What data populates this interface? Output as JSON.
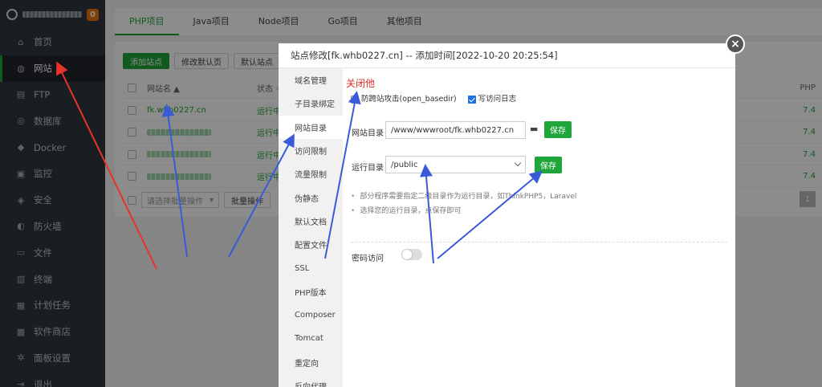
{
  "sidebar": {
    "badge": "0",
    "items": [
      {
        "label": "首页",
        "icon": "home-icon",
        "glyph": "⌂"
      },
      {
        "label": "网站",
        "icon": "globe-icon",
        "glyph": "◍"
      },
      {
        "label": "FTP",
        "icon": "ftp-icon",
        "glyph": "▤"
      },
      {
        "label": "数据库",
        "icon": "database-icon",
        "glyph": "◎"
      },
      {
        "label": "Docker",
        "icon": "docker-icon",
        "glyph": "◆"
      },
      {
        "label": "监控",
        "icon": "monitor-icon",
        "glyph": "▣"
      },
      {
        "label": "安全",
        "icon": "shield-icon",
        "glyph": "◈"
      },
      {
        "label": "防火墙",
        "icon": "firewall-icon",
        "glyph": "◐"
      },
      {
        "label": "文件",
        "icon": "folder-icon",
        "glyph": "▭"
      },
      {
        "label": "终端",
        "icon": "terminal-icon",
        "glyph": "▥"
      },
      {
        "label": "计划任务",
        "icon": "calendar-icon",
        "glyph": "▦"
      },
      {
        "label": "软件商店",
        "icon": "apps-icon",
        "glyph": "▩"
      },
      {
        "label": "面板设置",
        "icon": "gear-icon",
        "glyph": "✲"
      },
      {
        "label": "退出",
        "icon": "logout-icon",
        "glyph": "⇥"
      }
    ],
    "active_index": 1
  },
  "tabs": [
    "PHP项目",
    "Java项目",
    "Node项目",
    "Go项目",
    "其他项目"
  ],
  "toolbar": {
    "add_site": "添加站点",
    "default_page": "修改默认页",
    "default_site": "默认站点",
    "php": "PH"
  },
  "table": {
    "col_name": "网站名 ▲",
    "col_status": "状态 ◦",
    "col_php": "PHP",
    "rows": [
      {
        "name": "fk.whb0227.cn",
        "status": "运行中",
        "php": "7.4"
      },
      {
        "name": "",
        "status": "运行中",
        "php": "7.4"
      },
      {
        "name": "",
        "status": "运行中",
        "php": "7.4"
      },
      {
        "name": "",
        "status": "运行中",
        "php": "7.4"
      }
    ],
    "batch_select": "请选择批量操作",
    "batch_btn": "批量操作",
    "page": "1"
  },
  "modal": {
    "title": "站点修改[fk.whb0227.cn] -- 添加时间[2022-10-20 20:25:54]",
    "menu": [
      "域名管理",
      "子目录绑定",
      "网站目录",
      "访问限制",
      "流量限制",
      "伪静态",
      "默认文档",
      "配置文件",
      "SSL",
      "PHP版本",
      "Composer",
      "Tomcat",
      "重定向",
      "反向代理"
    ],
    "active_menu": 2,
    "note": "关闭他",
    "cb_basedir": "防跨站攻击(open_basedir)",
    "cb_log": "写访问日志",
    "site_dir_label": "网站目录",
    "site_dir_value": "/www/wwwroot/fk.whb0227.cn",
    "save": "保存",
    "run_dir_label": "运行目录",
    "run_dir_value": "/public",
    "tip1": "部分程序需要指定二级目录作为运行目录，如ThinkPHP5，Laravel",
    "tip2": "选择您的运行目录，点保存即可",
    "password_label": "密码访问"
  }
}
